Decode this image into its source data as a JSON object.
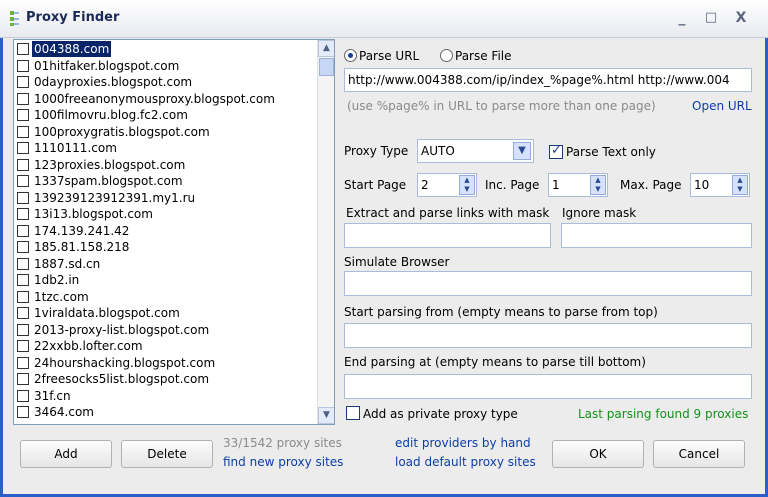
{
  "window": {
    "title": "Proxy Finder",
    "controls": [
      "_",
      "□",
      "X"
    ]
  },
  "sites": {
    "selected_index": 0,
    "items": [
      "004388.com",
      "01hitfaker.blogspot.com",
      "0dayproxies.blogspot.com",
      "1000freeanonymousproxy.blogspot.com",
      "100filmovru.blog.fc2.com",
      "100proxygratis.blogspot.com",
      "1110111.com",
      "123proxies.blogspot.com",
      "1337spam.blogspot.com",
      "139239123912391.my1.ru",
      "13i13.blogspot.com",
      "174.139.241.42",
      "185.81.158.218",
      "1887.sd.cn",
      "1db2.in",
      "1tzc.com",
      "1viraldata.blogspot.com",
      "2013-proxy-list.blogspot.com",
      "22xxbb.lofter.com",
      "24hourshacking.blogspot.com",
      "2freesocks5list.blogspot.com",
      "31f.cn",
      "3464.com"
    ],
    "checked": []
  },
  "parse": {
    "parse_url_label": "Parse URL",
    "parse_file_label": "Parse File",
    "mode": "url",
    "url_value": "http://www.004388.com/ip/index_%page%.html http://www.004",
    "url_hint": "(use %page% in URL to parse more than one page)",
    "open_url_label": "Open URL",
    "proxy_type_label": "Proxy Type",
    "proxy_type_value": "AUTO",
    "parse_text_only_label": "Parse Text only",
    "parse_text_only_checked": true,
    "start_page_label": "Start Page",
    "start_page_value": "2",
    "inc_page_label": "Inc. Page",
    "inc_page_value": "1",
    "max_page_label": "Max. Page",
    "max_page_value": "10",
    "extract_mask_label": "Extract and parse links with mask",
    "extract_mask_value": "",
    "ignore_mask_label": "Ignore mask",
    "ignore_mask_value": "",
    "simulate_browser_label": "Simulate Browser",
    "simulate_browser_value": "",
    "start_from_label": "Start parsing from (empty means to parse from top)",
    "start_from_value": "",
    "end_at_label": "End parsing at (empty means to parse till bottom)",
    "end_at_value": "",
    "private_label": "Add as private proxy type",
    "private_checked": false,
    "status": "Last parsing found 9 proxies"
  },
  "footer": {
    "add_label": "Add",
    "delete_label": "Delete",
    "count_text": "33/1542 proxy sites",
    "find_new_label": "find new proxy sites",
    "edit_by_hand_label": "edit providers by hand",
    "load_default_label": "load default proxy sites",
    "ok_label": "OK",
    "cancel_label": "Cancel"
  },
  "colors": {
    "window_frame": "#2a5fc9",
    "selection": "#0a246a",
    "link": "#0b3fa8",
    "status_green": "#129316"
  }
}
